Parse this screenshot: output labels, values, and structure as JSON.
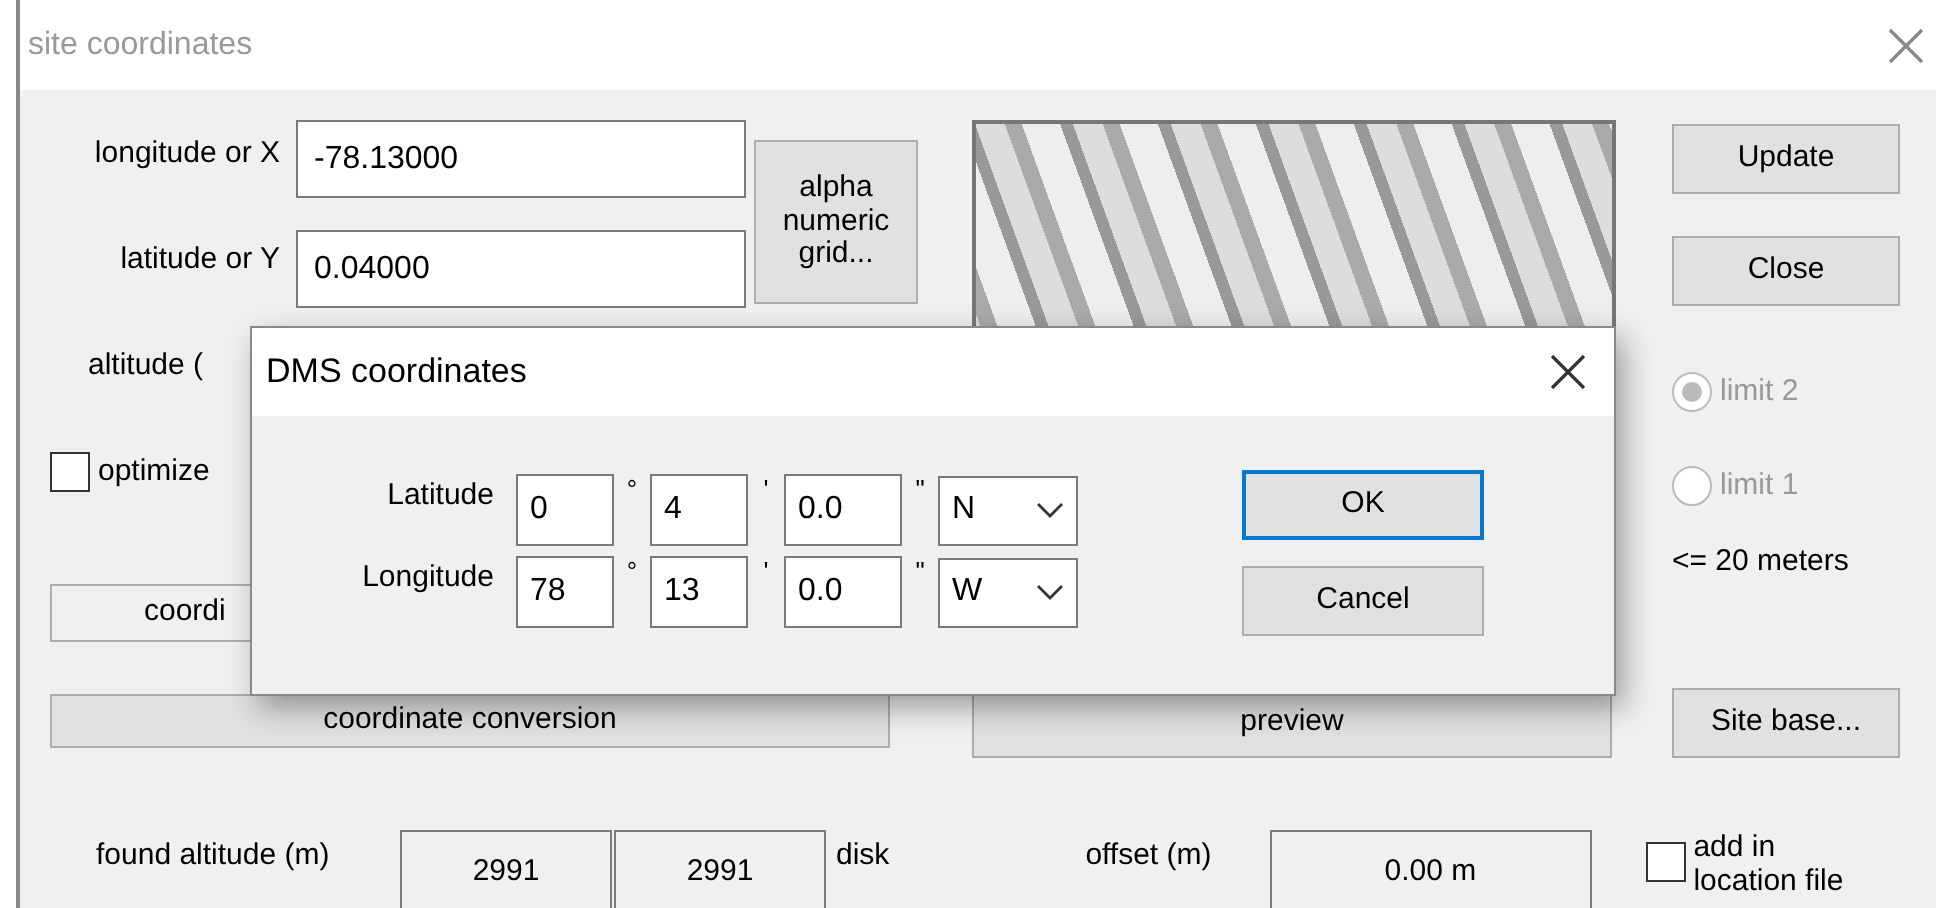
{
  "window": {
    "title": "site coordinates"
  },
  "fields": [
    {
      "label": "longitude or X",
      "value": "-78.13000"
    },
    {
      "label": "latitude or Y",
      "value": "0.04000"
    }
  ],
  "alpha_button": "alpha numeric grid...",
  "altitude_label": "altitude (",
  "optimize": {
    "label": "optimize",
    "checked": false
  },
  "coord_button": "coordi",
  "side_buttons": [
    "Update",
    "Close"
  ],
  "limits": [
    {
      "label": "limit 2",
      "selected": true,
      "disabled": true
    },
    {
      "label": "limit 1",
      "selected": false,
      "disabled": true
    }
  ],
  "tolerance": "<= 20 meters",
  "conversion_button": "coordinate conversion",
  "preview_button": "preview",
  "site_base_button": "Site base...",
  "found_altitude": {
    "label": "found altitude (m)",
    "values": [
      "2991",
      "2991"
    ],
    "suffix": "disk"
  },
  "offset": {
    "label": "offset (m)",
    "value": "0.00 m"
  },
  "add_in_location": {
    "label": "add in location file",
    "checked": false
  },
  "dialog": {
    "title": "DMS coordinates",
    "rows": [
      {
        "label": "Latitude",
        "degrees": "0",
        "degree_mark": "°",
        "minutes": "4",
        "minute_mark": "'",
        "seconds": "0.0",
        "second_mark": "\"",
        "hemisphere": "N"
      },
      {
        "label": "Longitude",
        "degrees": "78",
        "degree_mark": "°",
        "minutes": "13",
        "minute_mark": "'",
        "seconds": "0.0",
        "second_mark": "\"",
        "hemisphere": "W"
      }
    ],
    "buttons": [
      {
        "label": "OK",
        "focused": true
      },
      {
        "label": "Cancel",
        "focused": false
      }
    ]
  }
}
